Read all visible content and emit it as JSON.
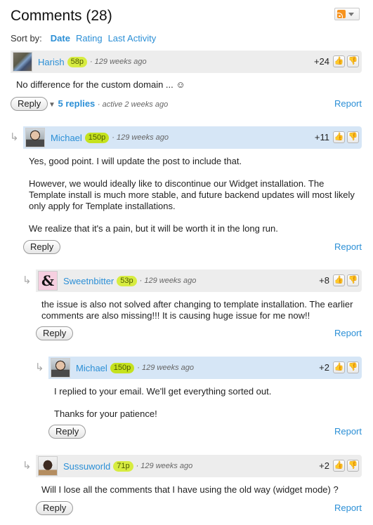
{
  "header": {
    "title": "Comments (28)",
    "rss_icon": "rss-feed-icon",
    "dropdown_icon": "caret-down-icon"
  },
  "sort": {
    "label": "Sort by:",
    "options": [
      {
        "label": "Date",
        "active": true
      },
      {
        "label": "Rating",
        "active": false
      },
      {
        "label": "Last Activity",
        "active": false
      }
    ]
  },
  "icons": {
    "vote_up": "thumbs-up-icon",
    "vote_down": "thumbs-down-icon",
    "reply_arrow": "reply-arrow-icon",
    "smiley": "smiley-icon"
  },
  "actions": {
    "reply": "Reply",
    "report": "Report"
  },
  "comments": [
    {
      "author": "Harish",
      "rep": "58p",
      "meta": "· 129 weeks ago",
      "score": "+24",
      "staff": false,
      "body": [
        "No difference for the custom domain ... ☺"
      ],
      "replies_toggle": {
        "arrow": "▼",
        "count": "5 replies",
        "activity": "· active 2 weeks ago"
      }
    },
    {
      "author": "Michael",
      "rep": "150p",
      "meta": "· 129 weeks ago",
      "score": "+11",
      "staff": true,
      "body": [
        "Yes, good point. I will update the post to include that.",
        "However, we would ideally like to discontinue our Widget installation. The Template install is much more stable, and future backend updates will most likely only apply for Template installations.",
        "We realize that it's a pain, but it will be worth it in the long run."
      ]
    },
    {
      "author": "Sweetnbitter",
      "rep": "53p",
      "meta": "· 129 weeks ago",
      "score": "+8",
      "staff": false,
      "body": [
        "the issue is also not solved after changing to template installation. The earlier comments are also missing!!! It is causing huge issue for me now!!"
      ]
    },
    {
      "author": "Michael",
      "rep": "150p",
      "meta": "· 129 weeks ago",
      "score": "+2",
      "staff": true,
      "body": [
        "I replied to your email. We'll get everything sorted out.",
        "Thanks for your patience!"
      ]
    },
    {
      "author": "Sussuworld",
      "rep": "71p",
      "meta": "· 129 weeks ago",
      "score": "+2",
      "staff": false,
      "body": [
        "Will I lose all the comments that I have using the old way (widget mode) ?"
      ]
    }
  ]
}
